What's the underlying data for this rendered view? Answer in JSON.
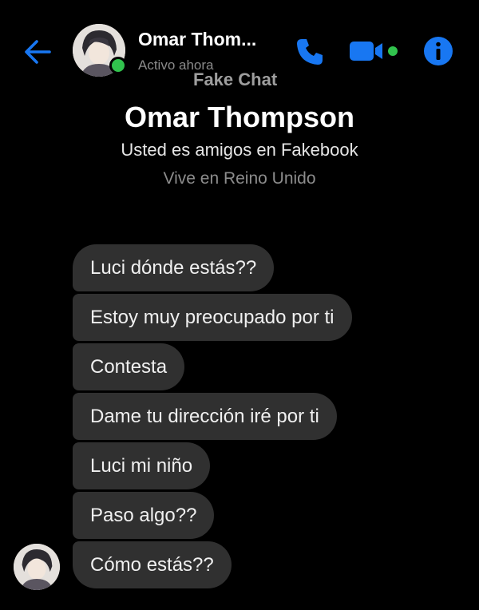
{
  "header": {
    "contact_name": "Omar Thom...",
    "status": "Activo ahora",
    "watermark": "Fake Chat",
    "icons": {
      "back": "back-arrow-icon",
      "call": "phone-icon",
      "video": "video-camera-icon",
      "info": "info-icon"
    },
    "accent_color": "#1877f2",
    "online_color": "#31c24d"
  },
  "profile": {
    "name": "Omar Thompson",
    "relation": "Usted es amigos en Fakebook",
    "location": "Vive en Reino Unido"
  },
  "messages": [
    "Luci dónde estás??",
    "Estoy muy preocupado por ti",
    "Contesta",
    "Dame tu dirección iré por ti",
    "Luci mi niño",
    "Paso algo??",
    "Cómo estás??"
  ]
}
